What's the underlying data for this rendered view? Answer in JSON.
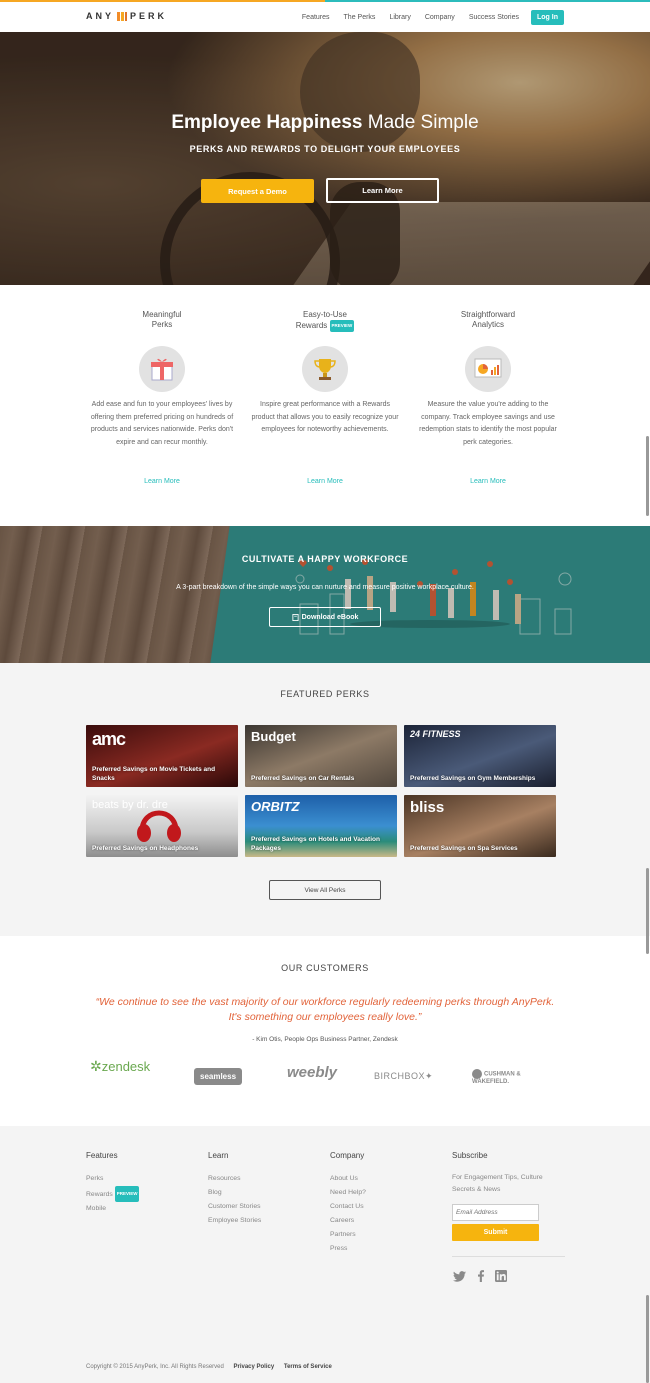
{
  "nav": {
    "logo": "ANYPERK",
    "links": [
      "Features",
      "The Perks",
      "Library",
      "Company",
      "Success Stories"
    ],
    "login": "Log In"
  },
  "hero": {
    "title_bold": "Employee Happiness",
    "title_rest": "Made Simple",
    "subtitle": "PERKS AND REWARDS TO DELIGHT YOUR EMPLOYEES",
    "cta_demo": "Request a Demo",
    "cta_learn": "Learn More"
  },
  "features": [
    {
      "title_1": "Meaningful",
      "title_2": "Perks",
      "icon": "gift-icon",
      "desc": "Add ease and fun to your employees' lives by offering them preferred pricing on hundreds of products and services nationwide. Perks don't expire and can recur monthly.",
      "link": "Learn More"
    },
    {
      "title_1": "Easy-to-Use",
      "title_2": "Rewards",
      "badge": "PREVIEW",
      "icon": "trophy-icon",
      "desc": "Inspire great performance with a Rewards product that allows you to easily recognize your employees for noteworthy achievements.",
      "link": "Learn More"
    },
    {
      "title_1": "Straightforward",
      "title_2": "Analytics",
      "icon": "analytics-icon",
      "desc": "Measure the value you're adding to the company. Track employee savings and use redemption stats to identify the most popular perk categories.",
      "link": "Learn More"
    }
  ],
  "ebook": {
    "title": "CULTIVATE A HAPPY WORKFORCE",
    "subtitle": "A 3-part breakdown of the simple ways you can nurture and measure positive workplace culture.",
    "button": "Download eBook",
    "button_icon": "book-icon"
  },
  "featured_perks": {
    "title": "FEATURED PERKS",
    "tiles": [
      {
        "brand": "amc",
        "caption": "Preferred Savings on Movie Tickets and Snacks",
        "bg": "#5a1a1a"
      },
      {
        "brand": "Budget",
        "caption": "Preferred Savings on Car Rentals",
        "bg": "#7a6a5a"
      },
      {
        "brand": "24 FITNESS",
        "caption": "Preferred Savings on Gym Memberships",
        "bg": "#2b3a55"
      },
      {
        "brand": "beats by dr. dre",
        "caption": "Preferred Savings on Headphones",
        "bg": "#d8d8d8"
      },
      {
        "brand": "ORBITZ",
        "caption": "Preferred Savings on Hotels and Vacation Packages",
        "bg": "#2a7fc0"
      },
      {
        "brand": "bliss",
        "caption": "Preferred Savings on Spa Services",
        "bg": "#7a5a45"
      }
    ],
    "view_all": "View All Perks"
  },
  "customers": {
    "title": "OUR CUSTOMERS",
    "quote": "“We continue to see the vast majority of our workforce regularly redeeming perks through AnyPerk. It's something our employees really love.”",
    "attribution": "- Kim Otis, People Ops Business Partner, Zendesk",
    "logos": [
      "zendesk",
      "seamless",
      "weebly",
      "BIRCHBOX",
      "CUSHMAN & WAKEFIELD."
    ]
  },
  "footer": {
    "features": {
      "heading": "Features",
      "links": [
        "Perks",
        "Rewards",
        "Mobile"
      ],
      "badge": "PREVIEW"
    },
    "learn": {
      "heading": "Learn",
      "links": [
        "Resources",
        "Blog",
        "Customer Stories",
        "Employee Stories"
      ]
    },
    "company": {
      "heading": "Company",
      "links": [
        "About Us",
        "Need Help?",
        "Contact Us",
        "Careers",
        "Partners",
        "Press"
      ]
    },
    "subscribe": {
      "heading": "Subscribe",
      "text": "For Engagement Tips, Culture Secrets & News",
      "email_placeholder": "Email Address",
      "submit": "Submit"
    },
    "social": [
      "twitter-icon",
      "facebook-icon",
      "linkedin-icon"
    ],
    "copyright": "Copyright © 2015 AnyPerk, Inc. All Rights Reserved",
    "privacy": "Privacy Policy",
    "terms": "Terms of Service"
  },
  "colors": {
    "accent": "#26bdbb",
    "cta": "#f6b40e",
    "quote": "#e2633a"
  }
}
